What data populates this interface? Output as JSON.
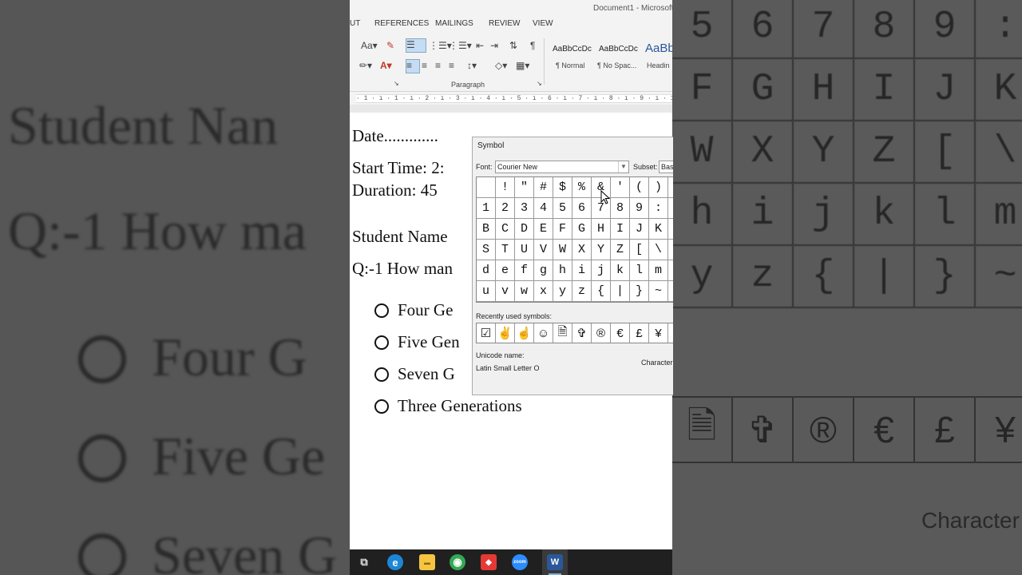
{
  "window": {
    "title": "Document1 - Microsoft"
  },
  "ribbon": {
    "tabs": [
      "UT",
      "REFERENCES",
      "MAILINGS",
      "REVIEW",
      "VIEW"
    ],
    "group_label": "Paragraph",
    "styles": [
      {
        "sample": "AaBbCcDc",
        "name": "¶ Normal"
      },
      {
        "sample": "AaBbCcDc",
        "name": "¶ No Spac..."
      },
      {
        "sample": "AaBb",
        "name": "Headin"
      }
    ]
  },
  "ruler": {
    "text": "· 1 · ı · 1 · ı · 2 · ı · 3 · ı · 4 · ı · 5 · ı · 6 · ı · 7 · ı · 8 · ı · 9 · ı · 10"
  },
  "document": {
    "date": "Date.............",
    "start_time": "Start Time: 2:",
    "duration": "Duration: 45",
    "student_name": "Student Name",
    "question": "Q:-1 How man",
    "options": [
      "Four Ge",
      "Five Gen",
      "Seven G",
      "Three Generations"
    ]
  },
  "symbol_dialog": {
    "title": "Symbol",
    "font_label": "Font:",
    "font_value": "Courier New",
    "subset_label": "Subset:",
    "subset_value": "Bas",
    "grid": [
      [
        " ",
        "!",
        "\"",
        "#",
        "$",
        "%",
        "&",
        "'",
        "(",
        ")",
        ""
      ],
      [
        "1",
        "2",
        "3",
        "4",
        "5",
        "6",
        "7",
        "8",
        "9",
        ":",
        ""
      ],
      [
        "B",
        "C",
        "D",
        "E",
        "F",
        "G",
        "H",
        "I",
        "J",
        "K",
        ""
      ],
      [
        "S",
        "T",
        "U",
        "V",
        "W",
        "X",
        "Y",
        "Z",
        "[",
        "\\",
        ""
      ],
      [
        "d",
        "e",
        "f",
        "g",
        "h",
        "i",
        "j",
        "k",
        "l",
        "m",
        ""
      ],
      [
        "u",
        "v",
        "w",
        "x",
        "y",
        "z",
        "{",
        "|",
        "}",
        "~",
        ""
      ]
    ],
    "recent_label": "Recently used symbols:",
    "recent": [
      "☑",
      "✌",
      "☝",
      "☺",
      "🗎",
      "✞",
      "®",
      "€",
      "£",
      "¥",
      ""
    ],
    "unicode_name_label": "Unicode name:",
    "unicode_name": "Latin Small Letter O",
    "character_label": "Character"
  },
  "background": {
    "left_lines": [
      "Student Nan",
      "Q:-1 How ma",
      "Four G",
      "Five Ge",
      "Seven G"
    ],
    "right_grid": [
      [
        "5",
        "6",
        "7",
        "8",
        "9",
        ":"
      ],
      [
        "F",
        "G",
        "H",
        "I",
        "J",
        "K"
      ],
      [
        "W",
        "X",
        "Y",
        "Z",
        "[",
        "\\"
      ],
      [
        "h",
        "i",
        "j",
        "k",
        "l",
        "m"
      ],
      [
        "y",
        "z",
        "{",
        "|",
        "}",
        "~"
      ]
    ],
    "right_recent": [
      "🗎",
      "✞",
      "®",
      "€",
      "£",
      "¥"
    ],
    "right_character_label": "Character"
  },
  "taskbar": {
    "items": [
      {
        "name": "task-view",
        "glyph": "⧉"
      },
      {
        "name": "edge",
        "glyph": "e"
      },
      {
        "name": "file-explorer",
        "glyph": "▬"
      },
      {
        "name": "chrome",
        "glyph": "◉"
      },
      {
        "name": "anydesk",
        "glyph": "◆"
      },
      {
        "name": "zoom",
        "glyph": "zoom"
      },
      {
        "name": "word",
        "glyph": "W"
      }
    ]
  },
  "colors": {
    "accent": "#2b579a",
    "taskbar": "#202020"
  }
}
